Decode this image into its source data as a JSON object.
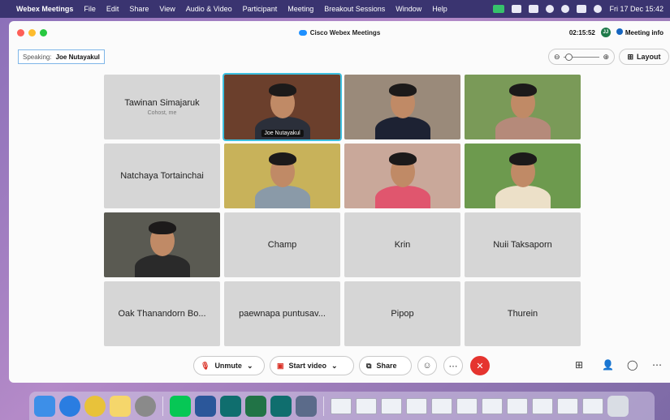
{
  "menubar": {
    "apple_icon": "apple-logo-icon",
    "items": [
      "Webex Meetings",
      "File",
      "Edit",
      "Share",
      "View",
      "Audio & Video",
      "Participant",
      "Meeting",
      "Breakout Sessions",
      "Window",
      "Help"
    ],
    "datetime": "Fri 17 Dec  15:42"
  },
  "window": {
    "title": "Cisco Webex Meetings",
    "timer": "02:15:52",
    "avatar_initials": "JJ",
    "meeting_info": "Meeting info"
  },
  "speaking": {
    "label": "Speaking:",
    "name": "Joe Nutayakul"
  },
  "zoom": {
    "out": "⊖",
    "in": "⊕"
  },
  "layout_label": "Layout",
  "participants": [
    {
      "name": "Tawinan Simajaruk",
      "sub": "Cohost, me",
      "video": false
    },
    {
      "name": "Joe Nutayakul",
      "video": true,
      "active": true,
      "bg": "#6b3f2c",
      "body": "#2b2f3a"
    },
    {
      "name": "",
      "video": true,
      "bg": "#9a8a7a",
      "body": "#1d2233"
    },
    {
      "name": "",
      "video": true,
      "bg": "#7a9a58",
      "body": "#b58a7a"
    },
    {
      "name": "Natchaya Tortainchai",
      "video": false
    },
    {
      "name": "",
      "video": true,
      "bg": "#c8b25a",
      "body": "#8a9aa8"
    },
    {
      "name": "",
      "video": true,
      "bg": "#c9a89a",
      "body": "#e0566e"
    },
    {
      "name": "",
      "video": true,
      "bg": "#6d9a4e",
      "body": "#ece0c8"
    },
    {
      "name": "",
      "video": true,
      "bg": "#5a5a52",
      "body": "#2a2a2a"
    },
    {
      "name": "Champ",
      "video": false
    },
    {
      "name": "Krin",
      "video": false
    },
    {
      "name": "Nuii Taksaporn",
      "video": false
    },
    {
      "name": "Oak Thanandorn Bo...",
      "video": false
    },
    {
      "name": "paewnapa puntusav...",
      "video": false
    },
    {
      "name": "Pipop",
      "video": false
    },
    {
      "name": "Thurein",
      "video": false
    }
  ],
  "controls": {
    "unmute": "Unmute",
    "start_video": "Start video",
    "share": "Share"
  },
  "colors": {
    "accent": "#3cc0e0",
    "end_call": "#e5342f",
    "menubar": "#3a3470"
  }
}
